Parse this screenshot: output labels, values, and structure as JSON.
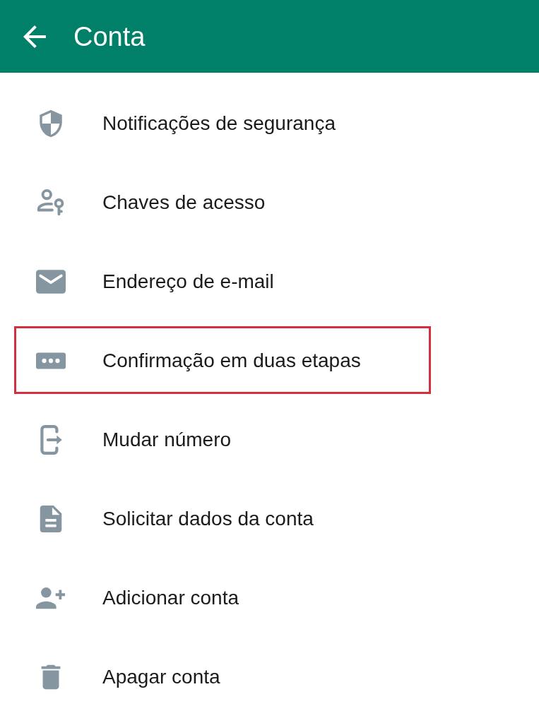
{
  "header": {
    "title": "Conta"
  },
  "items": [
    {
      "label": "Notificações de segurança",
      "highlighted": false
    },
    {
      "label": "Chaves de acesso",
      "highlighted": false
    },
    {
      "label": "Endereço de e-mail",
      "highlighted": false
    },
    {
      "label": "Confirmação em duas etapas",
      "highlighted": true
    },
    {
      "label": "Mudar número",
      "highlighted": false
    },
    {
      "label": "Solicitar dados da conta",
      "highlighted": false
    },
    {
      "label": "Adicionar conta",
      "highlighted": false
    },
    {
      "label": "Apagar conta",
      "highlighted": false
    }
  ]
}
